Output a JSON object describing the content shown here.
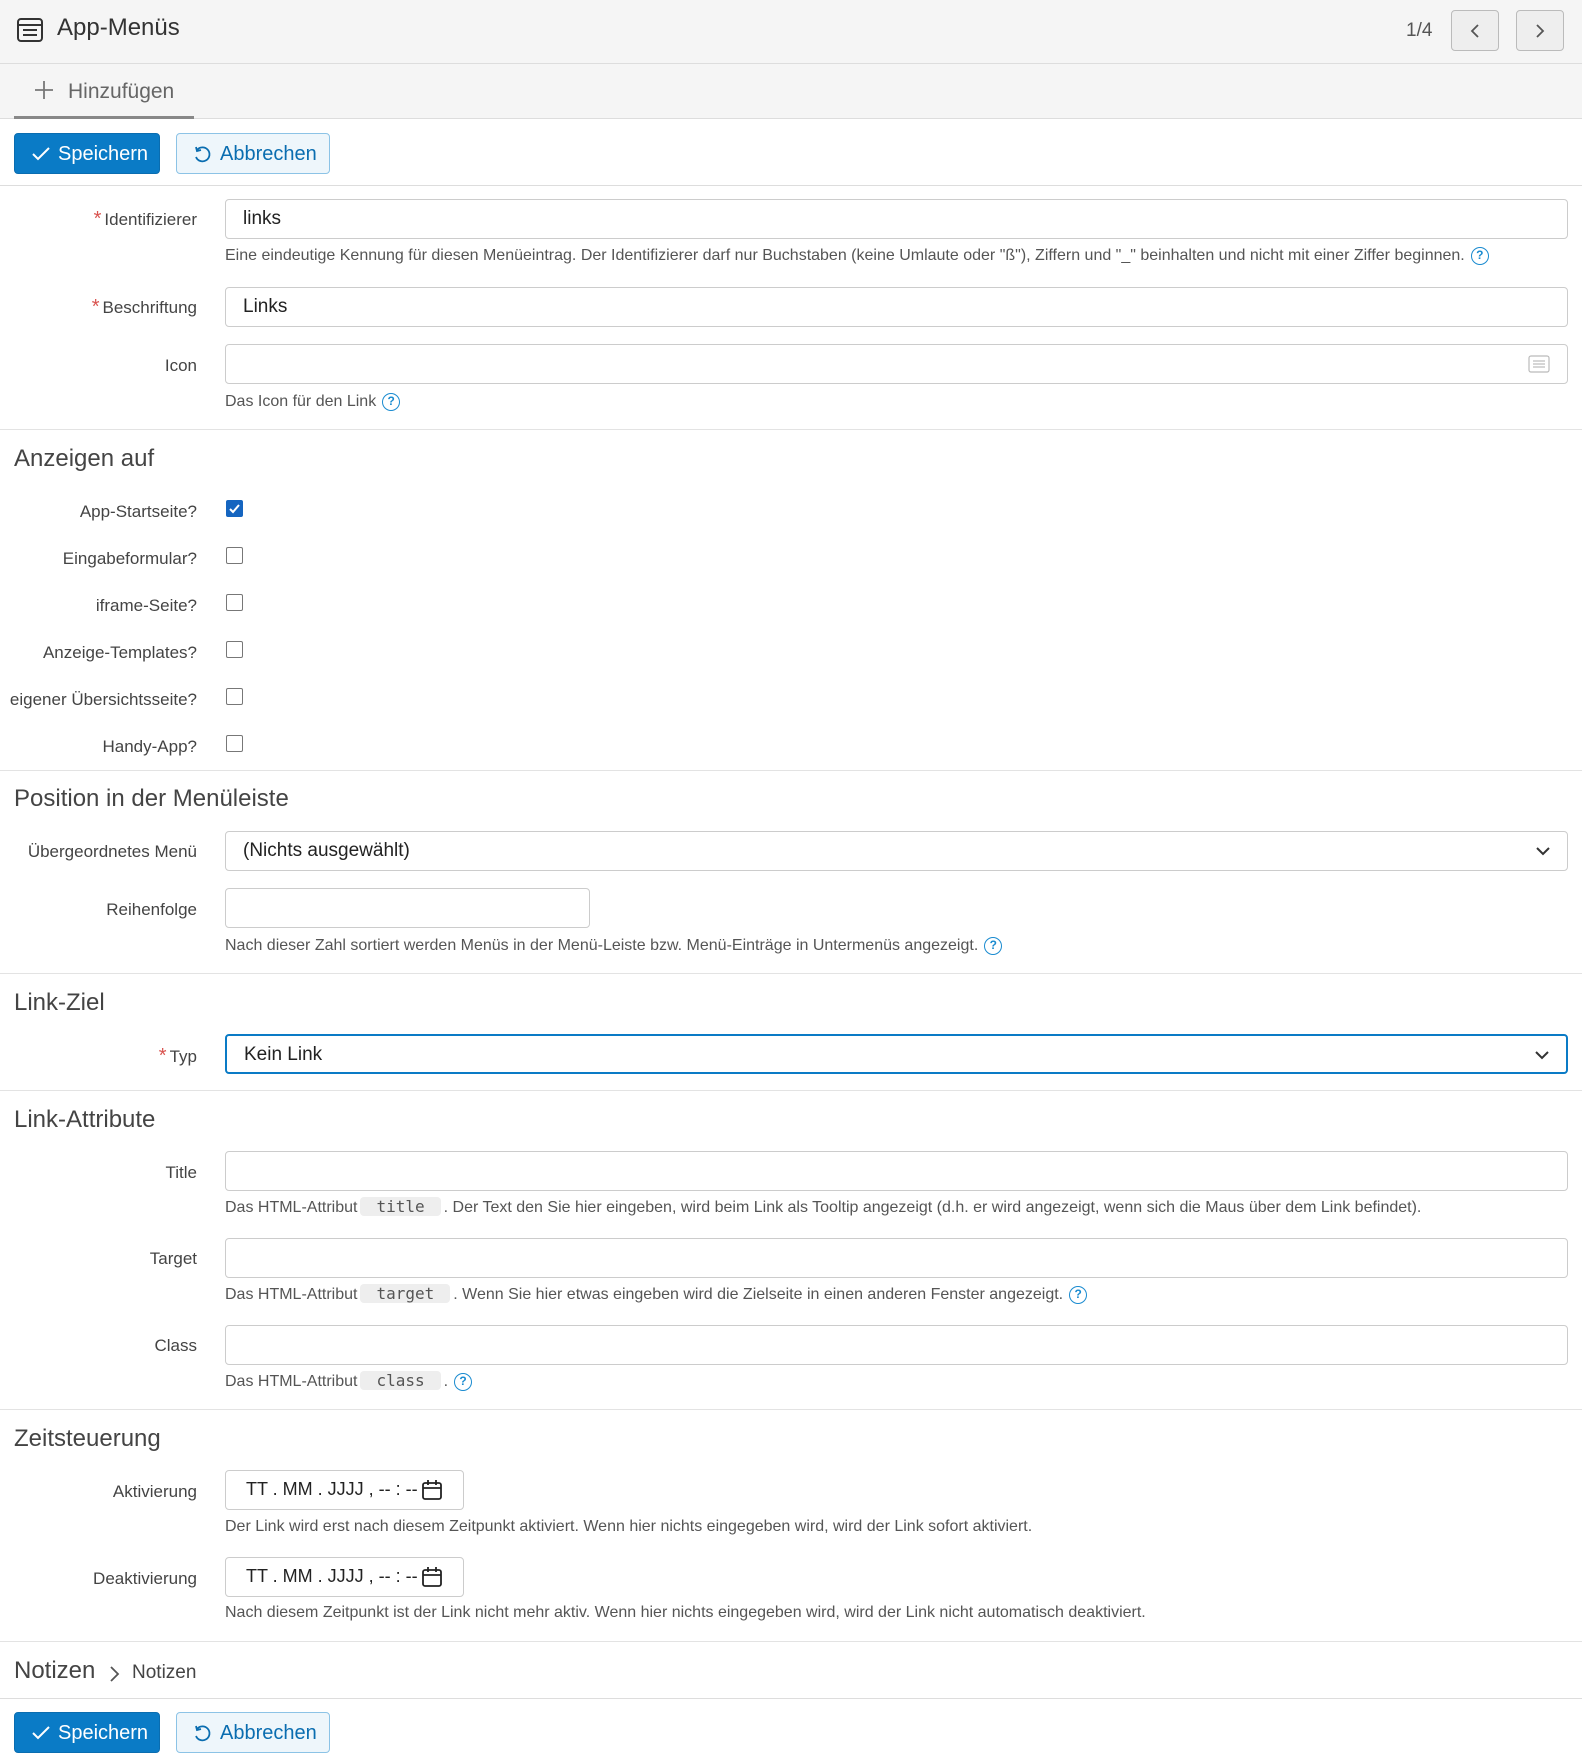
{
  "header": {
    "title": "App-Menüs",
    "pager": "1/4"
  },
  "tabs": {
    "add_label": "Hinzufügen"
  },
  "toolbar": {
    "save_label": "Speichern",
    "cancel_label": "Abbrechen"
  },
  "fields": {
    "identifier": {
      "label": "Identifizierer",
      "value": "links",
      "help": "Eine eindeutige Kennung für diesen Menüeintrag. Der Identifizierer darf nur Buchstaben (keine Umlaute oder \"ß\"), Ziffern und \"_\" beinhalten und nicht mit einer Ziffer beginnen."
    },
    "caption": {
      "label": "Beschriftung",
      "value": "Links"
    },
    "icon": {
      "label": "Icon",
      "value": "",
      "help": "Das Icon für den Link"
    }
  },
  "show_on": {
    "title": "Anzeigen auf",
    "items": [
      {
        "label": "App-Startseite?",
        "checked": true
      },
      {
        "label": "Eingabeformular?",
        "checked": false
      },
      {
        "label": "iframe-Seite?",
        "checked": false
      },
      {
        "label": "Anzeige-Templates?",
        "checked": false
      },
      {
        "label": "eigener Übersichtsseite?",
        "checked": false
      },
      {
        "label": "Handy-App?",
        "checked": false
      }
    ]
  },
  "position": {
    "title": "Position in der Menüleiste",
    "parent_label": "Übergeordnetes Menü",
    "parent_value": "(Nichts ausgewählt)",
    "order_label": "Reihenfolge",
    "order_value": "",
    "order_help": "Nach dieser Zahl sortiert werden Menüs in der Menü-Leiste bzw. Menü-Einträge in Untermenüs angezeigt."
  },
  "link_target": {
    "title": "Link-Ziel",
    "type_label": "Typ",
    "type_value": "Kein Link"
  },
  "link_attributes": {
    "title": "Link-Attribute",
    "title_label": "Title",
    "title_help_pre": "Das HTML-Attribut",
    "title_code": "title",
    "title_help_post": ". Der Text den Sie hier eingeben, wird beim Link als Tooltip angezeigt (d.h. er wird angezeigt, wenn sich die Maus über dem Link befindet).",
    "target_label": "Target",
    "target_help_pre": "Das HTML-Attribut",
    "target_code": "target",
    "target_help_post": ". Wenn Sie hier etwas eingeben wird die Zielseite in einen anderen Fenster angezeigt.",
    "class_label": "Class",
    "class_help_pre": "Das HTML-Attribut",
    "class_code": "class",
    "class_help_post": "."
  },
  "timing": {
    "title": "Zeitsteuerung",
    "activation_label": "Aktivierung",
    "activation_value": "TT . MM . JJJJ ,  -- : --",
    "activation_help": "Der Link wird erst nach diesem Zeitpunkt aktiviert. Wenn hier nichts eingegeben wird, wird der Link sofort aktiviert.",
    "deactivation_label": "Deaktivierung",
    "deactivation_value": "TT . MM . JJJJ ,  -- : --",
    "deactivation_help": "Nach diesem Zeitpunkt ist der Link nicht mehr aktiv. Wenn hier nichts eingegeben wird, wird der Link nicht automatisch deaktiviert."
  },
  "notes": {
    "title": "Notizen",
    "sub": "Notizen"
  },
  "colors": {
    "primary": "#0a7bc6",
    "required": "#d9534f"
  }
}
